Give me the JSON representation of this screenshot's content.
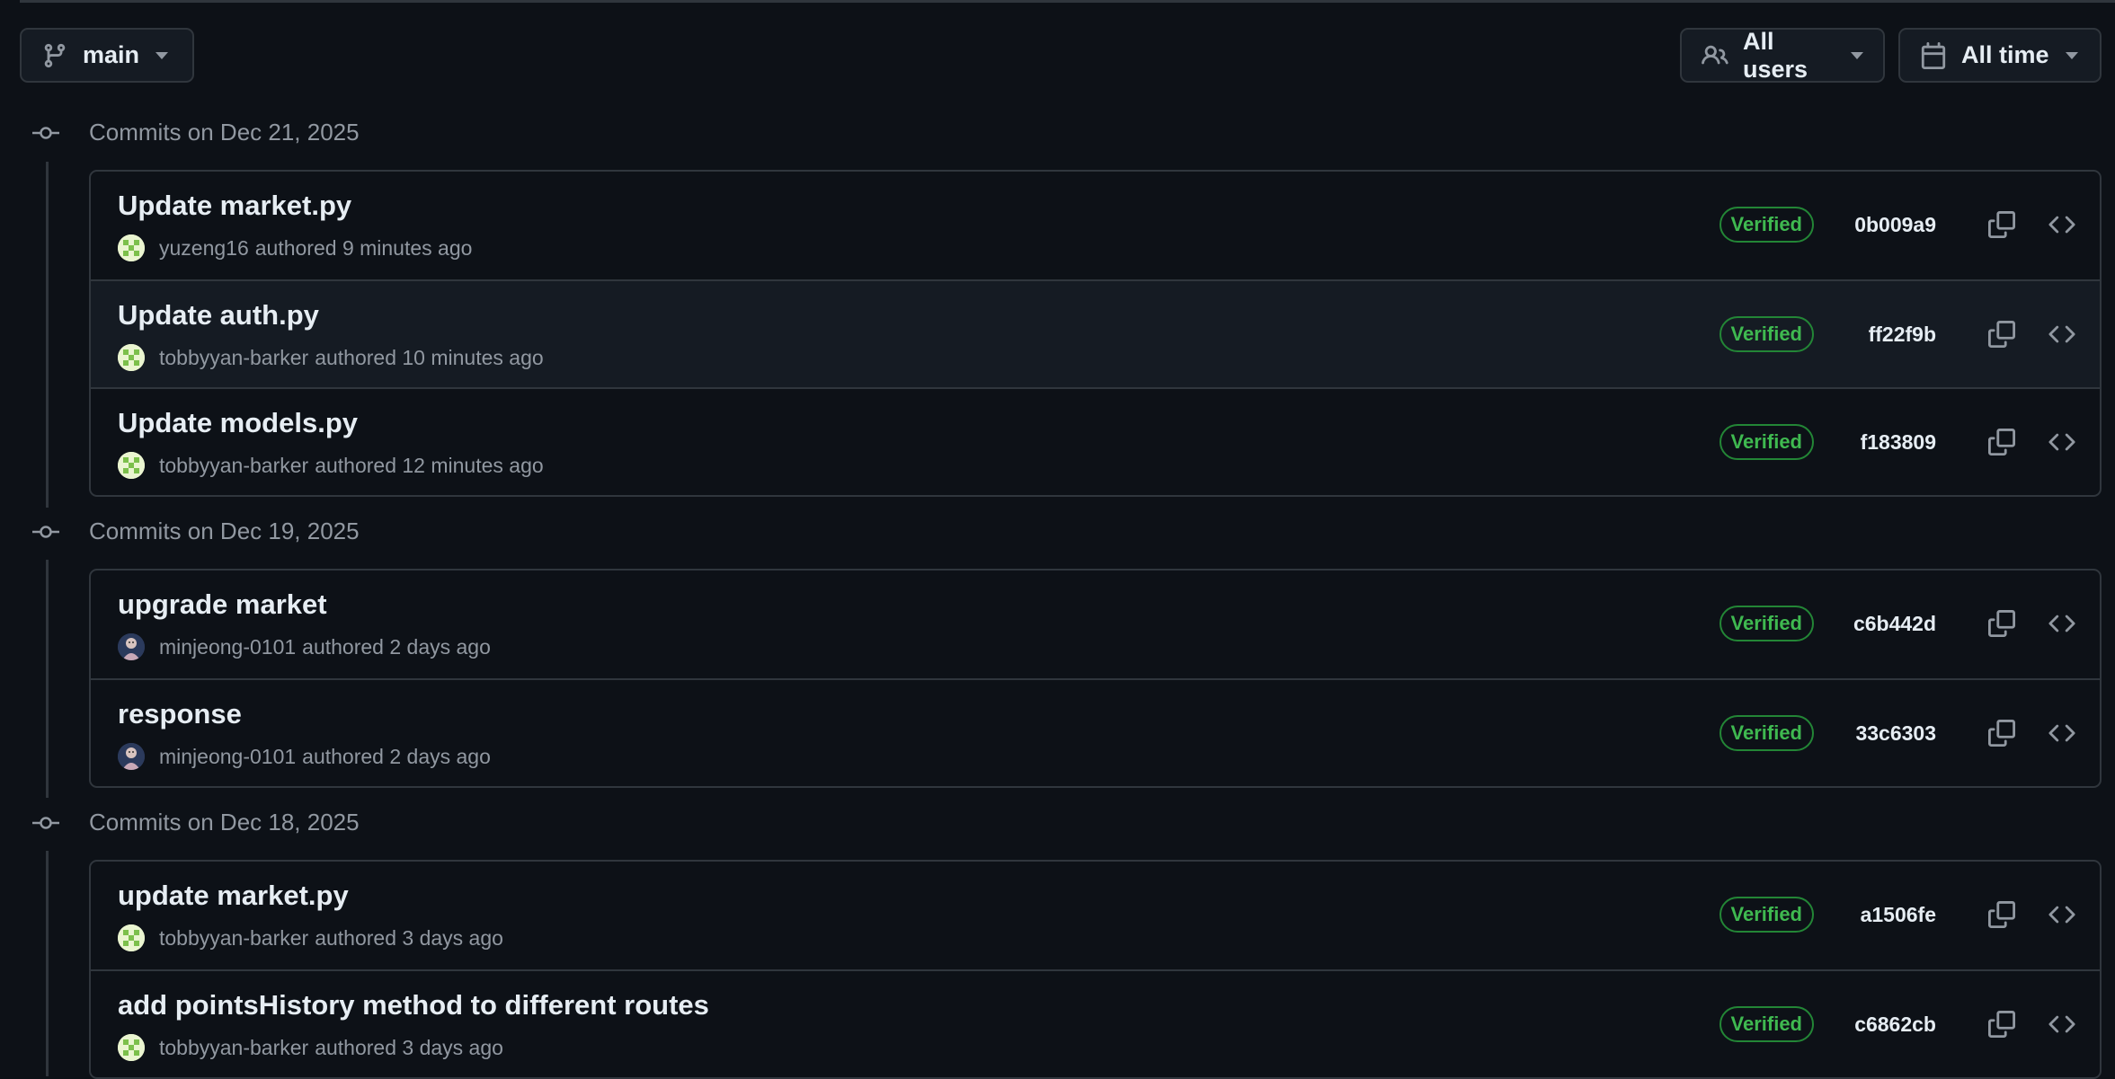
{
  "toolbar": {
    "branch_label": "main",
    "users_label": "All users",
    "time_label": "All time"
  },
  "groups": [
    {
      "title": "Commits on Dec 21, 2025",
      "commits": [
        {
          "title": "Update market.py",
          "author": "yuzeng16",
          "meta": "authored 9 minutes ago",
          "verified": "Verified",
          "sha": "0b009a9",
          "avatar": "green"
        },
        {
          "title": "Update auth.py",
          "author": "tobbyyan-barker",
          "meta": "authored 10 minutes ago",
          "verified": "Verified",
          "sha": "ff22f9b",
          "avatar": "green"
        },
        {
          "title": "Update models.py",
          "author": "tobbyyan-barker",
          "meta": "authored 12 minutes ago",
          "verified": "Verified",
          "sha": "f183809",
          "avatar": "green"
        }
      ]
    },
    {
      "title": "Commits on Dec 19, 2025",
      "commits": [
        {
          "title": "upgrade market",
          "author": "minjeong-0101",
          "meta": "authored 2 days ago",
          "verified": "Verified",
          "sha": "c6b442d",
          "avatar": "photo"
        },
        {
          "title": "response",
          "author": "minjeong-0101",
          "meta": "authored 2 days ago",
          "verified": "Verified",
          "sha": "33c6303",
          "avatar": "photo"
        }
      ]
    },
    {
      "title": "Commits on Dec 18, 2025",
      "commits": [
        {
          "title": "update market.py",
          "author": "tobbyyan-barker",
          "meta": "authored 3 days ago",
          "verified": "Verified",
          "sha": "a1506fe",
          "avatar": "green"
        },
        {
          "title": "add pointsHistory method to different routes",
          "author": "tobbyyan-barker",
          "meta": "authored 3 days ago",
          "verified": "Verified",
          "sha": "c6862cb",
          "avatar": "green"
        }
      ]
    }
  ],
  "icons": {
    "branch": "git-branch-icon",
    "users": "people-icon",
    "calendar": "calendar-icon",
    "copy": "copy-icon",
    "browse": "code-icon",
    "commit_node": "git-commit-icon"
  },
  "colors": {
    "background": "#0d1117",
    "border": "#30363d",
    "verified": "#3fb950",
    "muted_text": "#9198a1"
  }
}
